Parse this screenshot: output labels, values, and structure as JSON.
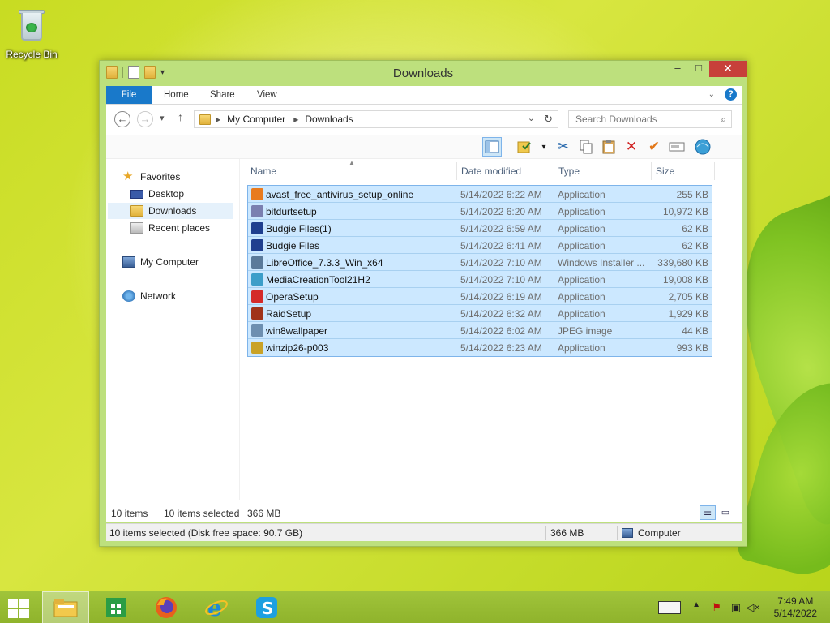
{
  "desktop": {
    "recycle_bin_label": "Recycle Bin"
  },
  "window": {
    "title": "Downloads",
    "buttons": {
      "minimize": "–",
      "maximize": "□",
      "close": "✕"
    }
  },
  "ribbon": {
    "tabs": [
      "File",
      "Home",
      "Share",
      "View"
    ],
    "collapse": "⌄",
    "help": "?"
  },
  "address": {
    "back": "←",
    "forward": "→",
    "recent": "▾",
    "up": "↑",
    "crumbs": [
      "My Computer",
      "Downloads"
    ],
    "dropdown": "⌄",
    "refresh": "↻",
    "search_placeholder": "Search Downloads",
    "search_icon": "⌕"
  },
  "nav_pane": {
    "favorites": "Favorites",
    "desktop": "Desktop",
    "downloads": "Downloads",
    "recent": "Recent places",
    "computer": "My Computer",
    "network": "Network"
  },
  "columns": {
    "name": "Name",
    "date": "Date modified",
    "type": "Type",
    "size": "Size"
  },
  "files": [
    {
      "name": "avast_free_antivirus_setup_online",
      "date": "5/14/2022 6:22 AM",
      "type": "Application",
      "size": "255 KB",
      "icon_color": "#e87b1f"
    },
    {
      "name": "bitdurtsetup",
      "date": "5/14/2022 6:20 AM",
      "type": "Application",
      "size": "10,972 KB",
      "icon_color": "#7a7fb0"
    },
    {
      "name": "Budgie Files(1)",
      "date": "5/14/2022 6:59 AM",
      "type": "Application",
      "size": "62 KB",
      "icon_color": "#1f3f8f"
    },
    {
      "name": "Budgie Files",
      "date": "5/14/2022 6:41 AM",
      "type": "Application",
      "size": "62 KB",
      "icon_color": "#1f3f8f"
    },
    {
      "name": "LibreOffice_7.3.3_Win_x64",
      "date": "5/14/2022 7:10 AM",
      "type": "Windows Installer ...",
      "size": "339,680 KB",
      "icon_color": "#5a7a9a"
    },
    {
      "name": "MediaCreationTool21H2",
      "date": "5/14/2022 7:10 AM",
      "type": "Application",
      "size": "19,008 KB",
      "icon_color": "#3c9ec9"
    },
    {
      "name": "OperaSetup",
      "date": "5/14/2022 6:19 AM",
      "type": "Application",
      "size": "2,705 KB",
      "icon_color": "#d42a2a"
    },
    {
      "name": "RaidSetup",
      "date": "5/14/2022 6:32 AM",
      "type": "Application",
      "size": "1,929 KB",
      "icon_color": "#a0331a"
    },
    {
      "name": "win8wallpaper",
      "date": "5/14/2022 6:02 AM",
      "type": "JPEG image",
      "size": "44 KB",
      "icon_color": "#6d8fb0"
    },
    {
      "name": "winzip26-p003",
      "date": "5/14/2022 6:23 AM",
      "type": "Application",
      "size": "993 KB",
      "icon_color": "#c9a227"
    }
  ],
  "status": {
    "item_count": "10 items",
    "selected": "10 items selected",
    "selected_size": "366 MB",
    "detail": "10 items selected (Disk free space: 90.7 GB)",
    "size": "366 MB",
    "location": "Computer"
  },
  "taskbar": {
    "clock_time": "7:49 AM",
    "clock_date": "5/14/2022"
  },
  "colors": {
    "accent": "#1979ca",
    "selection": "#cce8ff",
    "selection_border": "#7eb4ea",
    "window_frame": "#bde07d"
  }
}
